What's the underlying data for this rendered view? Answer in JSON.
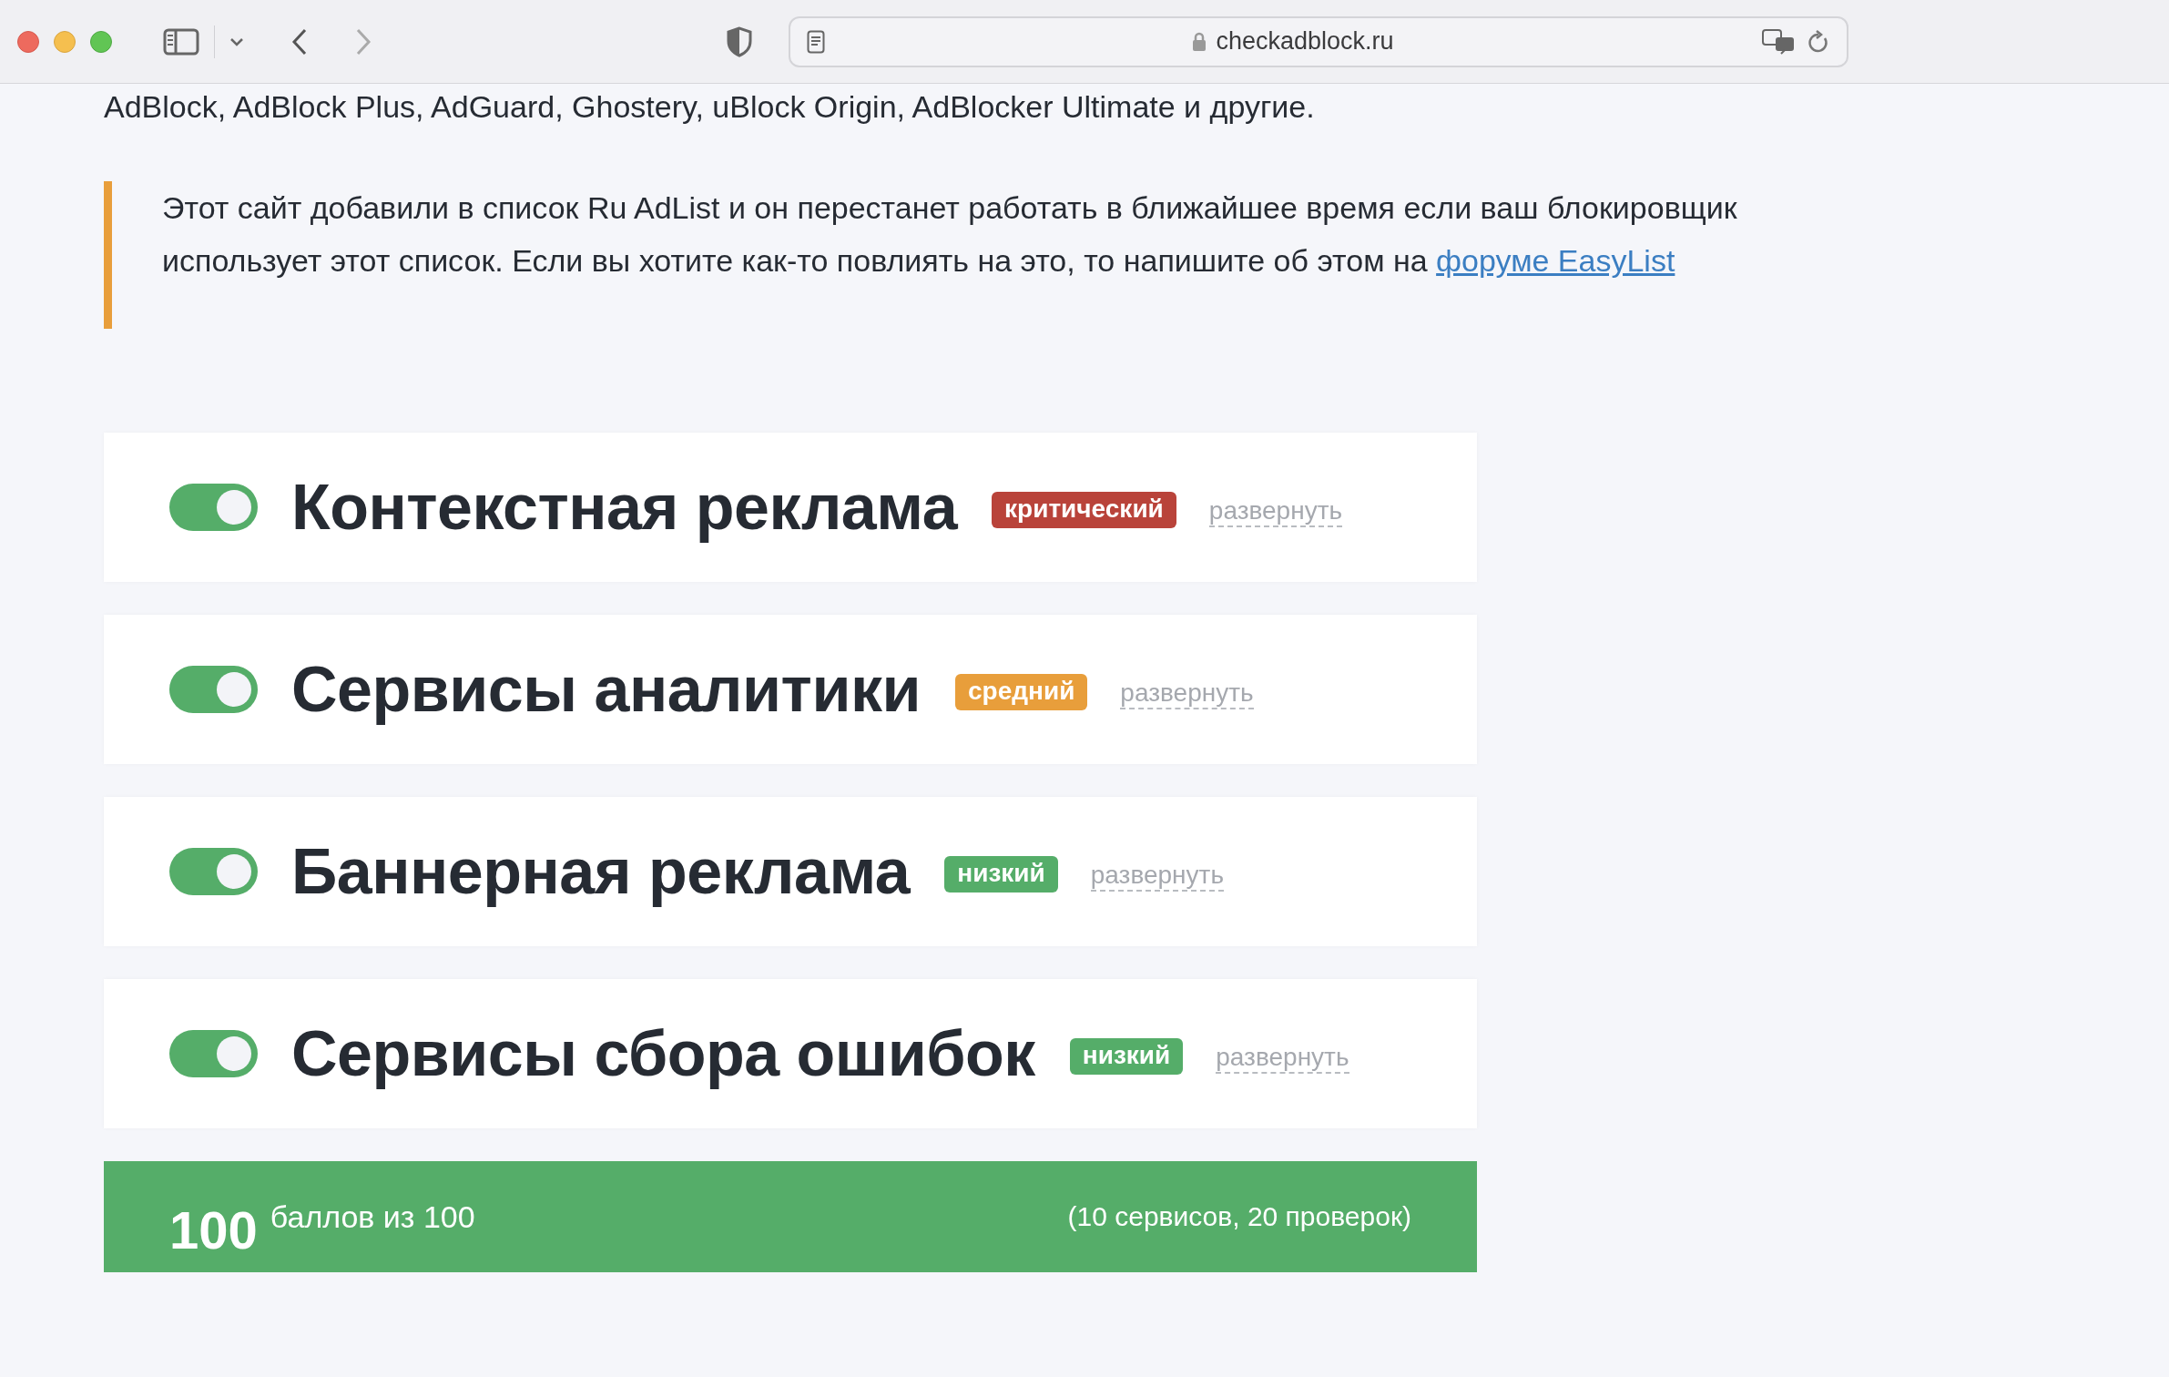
{
  "browser": {
    "url": "checkadblock.ru"
  },
  "intro_line": "AdBlock, AdBlock Plus, AdGuard, Ghostery, uBlock Origin, AdBlocker Ultimate и другие.",
  "notice": {
    "text": "Этот сайт добавили в список Ru AdList и он перестанет работать в ближайшее время если ваш блокировщик использует этот список. Если вы хотите как-то повлиять на это, то напишите об этом на",
    "link": "форуме EasyList"
  },
  "services": [
    {
      "title": "Контекстная реклама",
      "on": true,
      "badge": {
        "label": "критический",
        "color": "#b9433a"
      },
      "expand": "развернуть"
    },
    {
      "title": "Сервисы аналитики",
      "on": true,
      "badge": {
        "label": "средний",
        "color": "#e89e3b"
      },
      "expand": "развернуть"
    },
    {
      "title": "Баннерная реклама",
      "on": true,
      "badge": {
        "label": "низкий",
        "color": "#55ad69"
      },
      "expand": "развернуть"
    },
    {
      "title": "Сервисы сбора ошибок",
      "on": true,
      "badge": {
        "label": "низкий",
        "color": "#55ad69"
      },
      "expand": "развернуть"
    }
  ],
  "score": {
    "value": "100",
    "label": "баллов из 100",
    "details": "(10 сервисов, 20 проверок)"
  }
}
